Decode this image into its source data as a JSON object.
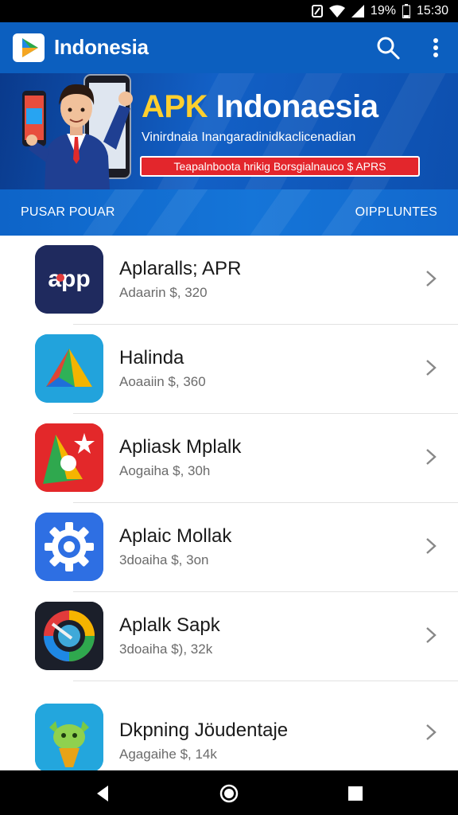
{
  "status_bar": {
    "battery": "19%",
    "time": "15:30"
  },
  "app_bar": {
    "title": "Indonesia"
  },
  "banner": {
    "title_part1": "APK",
    "title_part2": " Indonaesia",
    "subtitle": "Vinirdnaia Inangaradinidkaclicenadian",
    "tag": "Teapalnboota hrikig Borsgialnauco $ APRS"
  },
  "tabs": {
    "left": "PUSAR POUAR",
    "right": "OIPPLUNTES"
  },
  "apps": [
    {
      "name": "Aplaralls; APR",
      "price": "Adaarin $, 320",
      "icon": "app-logo-icon",
      "icon_text": "app"
    },
    {
      "name": "Halinda",
      "price": "Aoaaiin $, 360",
      "icon": "triangle-play-icon"
    },
    {
      "name": "Apliask Mplalk",
      "price": "Aogaiha $, 30h",
      "icon": "spark-logo-icon"
    },
    {
      "name": "Aplaic Mollak",
      "price": "3doaiha $, 3on",
      "icon": "gear-icon"
    },
    {
      "name": "Aplalk Sapk",
      "price": "3doaiha $), 32k",
      "icon": "color-wheel-icon"
    },
    {
      "name": "Dkpning Jöudentaje",
      "price": "Agagaihe $, 14k",
      "icon": "plant-mascot-icon"
    }
  ],
  "colors": {
    "app_bar": "#0c5fbf",
    "banner": "#0a3a8c",
    "accent_yellow": "#ffcf2e",
    "tag_red": "#e3262c"
  }
}
